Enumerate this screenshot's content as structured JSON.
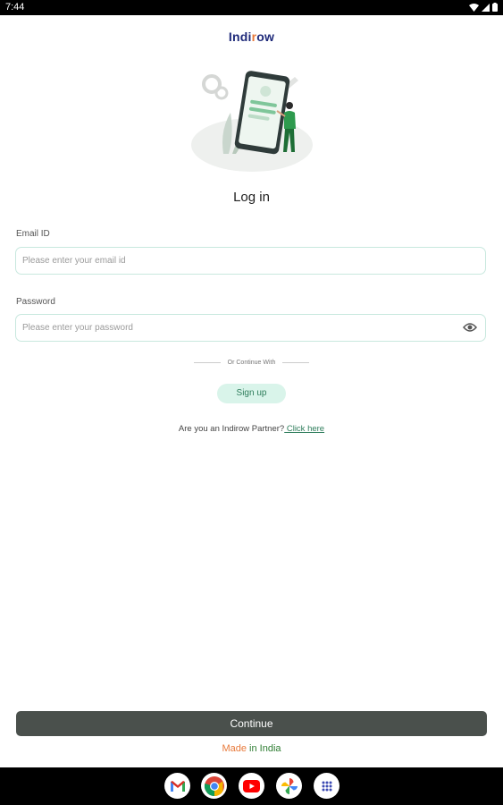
{
  "status_bar": {
    "time": "7:44"
  },
  "logo": {
    "part1": "Indi",
    "part2": "r",
    "part3": "ow"
  },
  "title": "Log in",
  "email": {
    "label": "Email ID",
    "placeholder": "Please enter your email id",
    "value": ""
  },
  "password": {
    "label": "Password",
    "placeholder": "Please enter your password",
    "value": ""
  },
  "divider_text": "Or Continue With",
  "signup_label": "Sign up",
  "partner": {
    "question": "Are you an Indirow Partner?",
    "link": " Click here"
  },
  "continue_label": "Continue",
  "footer": {
    "part1": "Made",
    "part2": " in India"
  },
  "dock": [
    "gmail-icon",
    "chrome-icon",
    "youtube-icon",
    "photos-icon",
    "apps-icon"
  ],
  "colors": {
    "accent_green": "#2e7d5b",
    "brand_navy": "#1f2a7a",
    "brand_orange": "#e8793a",
    "button_dark": "#4a504c"
  }
}
